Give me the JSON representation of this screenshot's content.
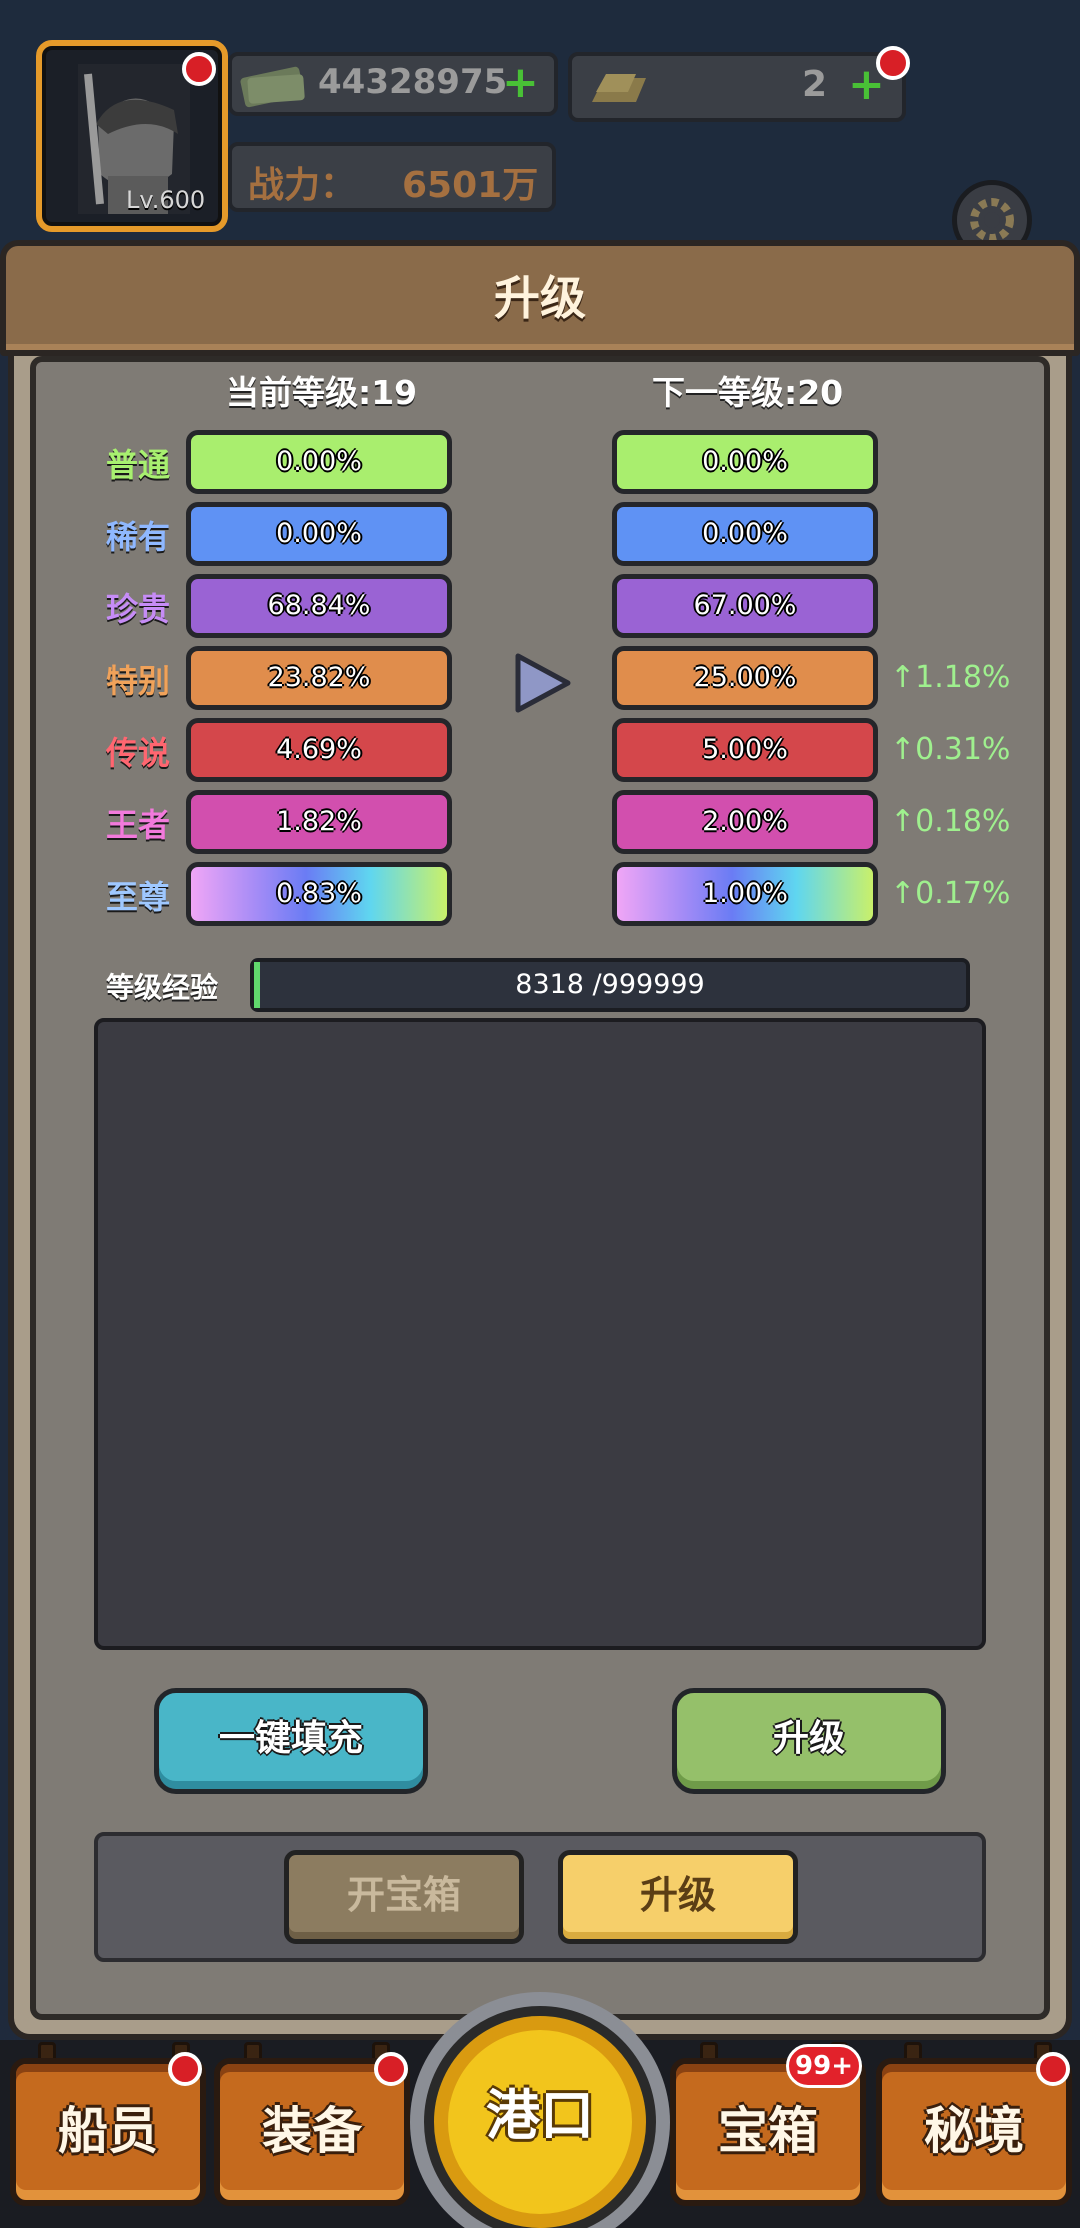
{
  "hud": {
    "avatar_level": "Lv.600",
    "money": "44328975",
    "gold": "2",
    "power_label": "战力：",
    "power_value": "6501万"
  },
  "panel": {
    "title": "升级",
    "current_level": "当前等级:19",
    "next_level": "下一等级:20",
    "tiers": [
      {
        "name": "普通",
        "current": "0.00%",
        "next": "0.00%",
        "delta": "",
        "label_color": "#a8f070",
        "bar_color": "#a9ee6e"
      },
      {
        "name": "稀有",
        "current": "0.00%",
        "next": "0.00%",
        "delta": "",
        "label_color": "#8fb8ff",
        "bar_color": "#5f92f4"
      },
      {
        "name": "珍贵",
        "current": "68.84%",
        "next": "67.00%",
        "delta": "",
        "label_color": "#c68cf6",
        "bar_color": "#9a63d4"
      },
      {
        "name": "特别",
        "current": "23.82%",
        "next": "25.00%",
        "delta": "↑1.18%",
        "label_color": "#f0a25a",
        "bar_color": "#e08d4c"
      },
      {
        "name": "传说",
        "current": "4.69%",
        "next": "5.00%",
        "delta": "↑0.31%",
        "label_color": "#ff6670",
        "bar_color": "#d4474b"
      },
      {
        "name": "王者",
        "current": "1.82%",
        "next": "2.00%",
        "delta": "↑0.18%",
        "label_color": "#f27adc",
        "bar_color": "#d24fae"
      },
      {
        "name": "至尊",
        "current": "0.83%",
        "next": "1.00%",
        "delta": "↑0.17%",
        "label_color": "#9fc8ff",
        "bar_color": "rainbow"
      }
    ],
    "exp_label": "等级经验",
    "exp_text": "8318 /999999",
    "exp_fraction": 0.0083,
    "fill_button": "一键填充",
    "upgrade_button": "升级",
    "tab_open_chest": "开宝箱",
    "tab_upgrade": "升级"
  },
  "nav": {
    "crew": "船员",
    "equipment": "装备",
    "port": "港口",
    "chest": "宝箱",
    "chest_badge": "99+",
    "secret_realm": "秘境"
  },
  "icons": [
    "avatar-portrait",
    "cash-icon",
    "gold-bar-icon",
    "plus-icon",
    "gear-icon",
    "play-arrow-icon"
  ]
}
